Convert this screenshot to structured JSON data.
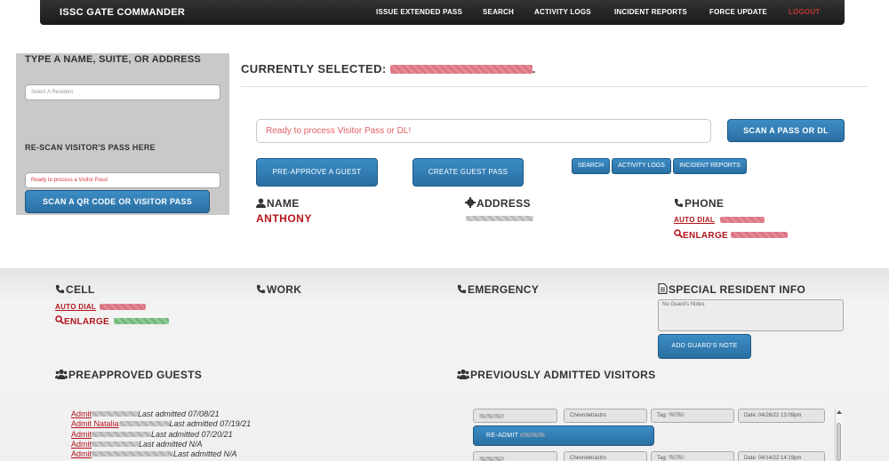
{
  "nav": {
    "brand": "ISSC GATE COMMANDER",
    "items": [
      "ISSUE EXTENDED PASS",
      "SEARCH",
      "ACTIVITY LOGS",
      "INCIDENT REPORTS",
      "FORCE UPDATE"
    ],
    "logout": "LOGOUT"
  },
  "left_panel": {
    "search_title": "TYPE A NAME, SUITE, OR ADDRESS",
    "resident_placeholder": "Select A Resident",
    "rescan_title": "RE-SCAN VISITOR'S PASS HERE",
    "rescan_status": "Ready to process a Visitor Pass!",
    "scan_qr_label": "SCAN A QR CODE OR VISITOR PASS"
  },
  "selected": {
    "label": "CURRENTLY SELECTED:",
    "suffix": "."
  },
  "scan": {
    "status_text": "Ready to process Visitor Pass or DL!",
    "scan_button": "SCAN A PASS OR DL"
  },
  "actions": {
    "preapprove": "PRE-APPROVE A GUEST",
    "create_pass": "CREATE GUEST PASS",
    "search": "SEARCH",
    "activity_logs": "ACTIVITY LOGS",
    "incident_reports": "INCIDENT REPORTS"
  },
  "resident": {
    "name_label": "NAME",
    "name_value": "ANTHONY",
    "address_label": "ADDRESS",
    "phone_label": "PHONE",
    "auto_dial": "AUTO DIAL",
    "enlarge": "ENLARGE"
  },
  "contacts": {
    "cell_label": "CELL",
    "cell_auto_dial": "AUTO DIAL",
    "cell_enlarge": "ENLARGE",
    "work_label": "WORK",
    "emergency_label": "EMERGENCY",
    "special_label": "SPECIAL RESIDENT INFO",
    "notes_placeholder": "No Guard's Notes",
    "add_note": "ADD GUARD'S NOTE"
  },
  "preapproved": {
    "title": "PREAPPROVED GUESTS",
    "guests": [
      {
        "link": "Admit",
        "name": "",
        "date": "Last admitted 07/08/21"
      },
      {
        "link": "Admit Natalia",
        "name": "",
        "date": "Last admitted 07/19/21"
      },
      {
        "link": "Admit",
        "name": "",
        "date": "Last admitted 07/20/21"
      },
      {
        "link": "Admit",
        "name": "",
        "date": "Last admitted N/A"
      },
      {
        "link": "Admit",
        "name": "",
        "date": "Last admitted N/A"
      }
    ]
  },
  "previous": {
    "title": "PREVIOUSLY ADMITTED VISITORS",
    "rows": [
      {
        "vehicle": "Chevrolet/astro",
        "tag": "Tag:",
        "date": "Date: 04/26/22 13:09pm",
        "readmit": "RE-ADMIT"
      },
      {
        "vehicle": "Chevrolet/astro",
        "tag": "Tag:",
        "date": "Date: 04/14/22 14:19pm"
      }
    ]
  },
  "colors": {
    "accent_blue": "#2f7db8",
    "danger_red": "#b3141c",
    "nav_bg": "#222222",
    "panel_gray": "#c9c9c9"
  }
}
